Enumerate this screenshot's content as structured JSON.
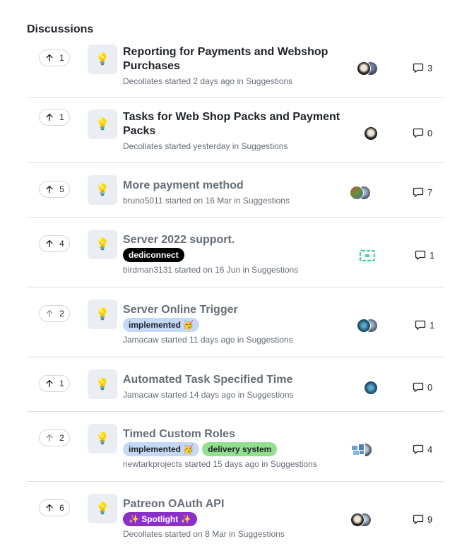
{
  "heading": "Discussions",
  "discussions": [
    {
      "upvotes": "1",
      "title_line1": "Reporting for Payments and Webshop",
      "title_line2": "Purchases",
      "author": "Decollates",
      "started": "started 2 days ago in",
      "category": "Suggestions",
      "comments": "3",
      "read": false
    },
    {
      "upvotes": "1",
      "title_line1": "Tasks for Web Shop Packs and Payment",
      "title_line2": "Packs",
      "author": "Decollates",
      "started": "started yesterday in",
      "category": "Suggestions",
      "comments": "0",
      "read": false
    },
    {
      "upvotes": "5",
      "title": "More payment method",
      "author": "bruno5011",
      "started": "started on 16 Mar in",
      "category": "Suggestions",
      "comments": "7",
      "read": true
    },
    {
      "upvotes": "4",
      "title": "Server 2022 support.",
      "labels": [
        {
          "text": "dediconnect",
          "bg": "#000000",
          "fg": "#ffffff"
        }
      ],
      "author": "birdman3131",
      "started": "started on 16 Jun in",
      "category": "Suggestions",
      "comments": "1",
      "read": true
    },
    {
      "upvotes": "2",
      "title": "Server Online Trigger",
      "labels": [
        {
          "text": "implemented 🥳",
          "bg": "#c5d9f7",
          "fg": "#1f2328"
        }
      ],
      "author": "Jamacaw",
      "started": "started 11 days ago in",
      "category": "Suggestions",
      "comments": "1",
      "read": true
    },
    {
      "upvotes": "1",
      "title": "Automated Task Specified Time",
      "author": "Jamacaw",
      "started": "started 14 days ago in",
      "category": "Suggestions",
      "comments": "0",
      "read": true
    },
    {
      "upvotes": "2",
      "title": "Timed Custom Roles",
      "labels": [
        {
          "text": "implemented 🥳",
          "bg": "#c5d9f7",
          "fg": "#1f2328"
        },
        {
          "text": "delivery system",
          "bg": "#92e08f",
          "fg": "#1f2328"
        }
      ],
      "author": "newtarkprojects",
      "started": "started 15 days ago in",
      "category": "Suggestions",
      "comments": "4",
      "read": true
    },
    {
      "upvotes": "6",
      "title": "Patreon OAuth API",
      "labels": [
        {
          "text": "✨ Spotlight ✨",
          "bg": "#8a2fc8",
          "fg": "#ffffff"
        }
      ],
      "author": "Decollates",
      "started": "started on 8 Mar in",
      "category": "Suggestions",
      "comments": "9",
      "read": true
    }
  ],
  "icons": {
    "upvote": "arrow-up-icon",
    "category": "lightbulb-icon",
    "comment": "comment-icon"
  },
  "colors": {
    "text": "#1f2328",
    "muted": "#656d76",
    "border": "#d0d7de",
    "divider": "#d8dee4",
    "category_bg": "#eaeef2"
  }
}
